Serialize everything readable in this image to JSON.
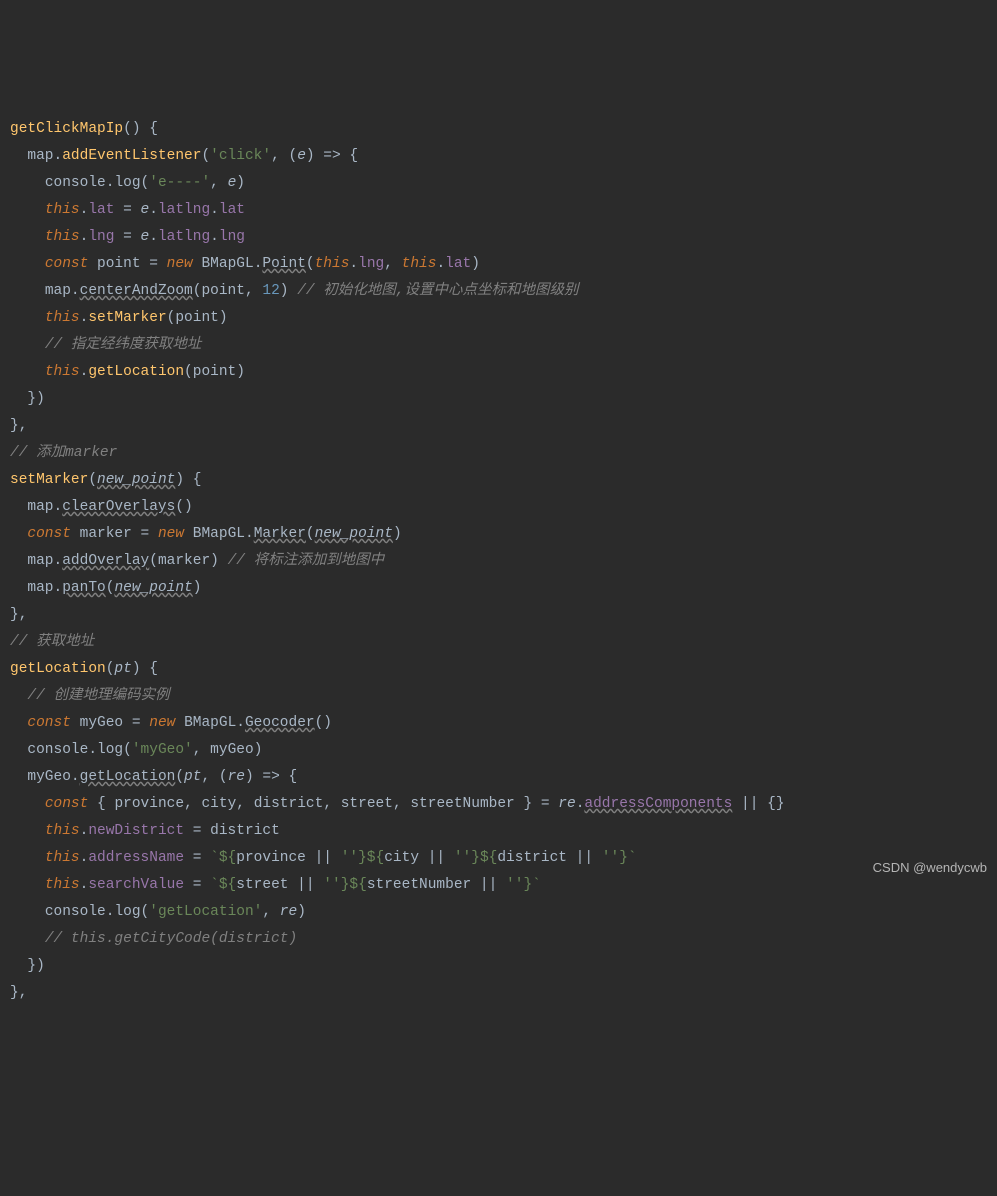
{
  "code": {
    "fn1_name": "getClickMapIp",
    "addEventListener": "addEventListener",
    "click_str": "'click'",
    "e_param": "e",
    "arrow": " => ",
    "console": "console",
    "log": "log",
    "e_dash_str": "'e----'",
    "e_arg": "e",
    "this_kw": "this",
    "lat": "lat",
    "lng": "lng",
    "latlng": "latlng",
    "const_kw": "const",
    "new_kw": "new",
    "point_var": "point",
    "BMapGL": "BMapGL",
    "Point": "Point",
    "map_var": "map",
    "centerAndZoom": "centerAndZoom",
    "num12": "12",
    "comment_init": "// 初始化地图,设置中心点坐标和地图级别",
    "setMarker": "setMarker",
    "comment_latlng": "// 指定经纬度获取地址",
    "getLocation": "getLocation",
    "comment_addmarker": "// 添加marker",
    "fn2_name": "setMarker",
    "new_point": "new_point",
    "clearOverlays": "clearOverlays",
    "marker_var": "marker",
    "Marker": "Marker",
    "addOverlay": "addOverlay",
    "comment_addoverlay": "// 将标注添加到地图中",
    "panTo": "panTo",
    "comment_getaddr": "// 获取地址",
    "fn3_name": "getLocation",
    "pt_param": "pt",
    "comment_geocoder": "// 创建地理编码实例",
    "myGeo_var": "myGeo",
    "Geocoder": "Geocoder",
    "myGeo_str": "'myGeo'",
    "re_param": "re",
    "province": "province",
    "city": "city",
    "district": "district",
    "street": "street",
    "streetNumber": "streetNumber",
    "addressComponents": "addressComponents",
    "newDistrict": "newDistrict",
    "addressName": "addressName",
    "searchValue": "searchValue",
    "emptystr": "''",
    "getLocation_str": "'getLocation'",
    "comment_getcitycode": "// this.getCityCode(district)"
  },
  "watermark": "CSDN @wendycwb"
}
